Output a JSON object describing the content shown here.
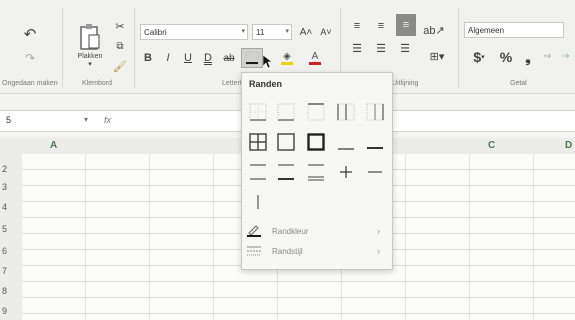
{
  "ribbon": {
    "undo_label": "Ongedaan maken",
    "clipboard_label": "Klembord",
    "paste_label": "Plakken",
    "font_group_label": "Lettertype",
    "align_group_label": "Uitlijning",
    "number_group_label": "Getal",
    "font_name": "Calibri",
    "font_size": "11",
    "grow_font": "A˄",
    "shrink_font": "A˅",
    "bold": "B",
    "italic": "I",
    "underline": "U",
    "double_underline": "D",
    "strikethrough": "ab",
    "number_format": "Algemeen",
    "currency": "$",
    "percent": "%",
    "comma": "❟"
  },
  "formula_bar": {
    "name_box": "5",
    "fx": "fx"
  },
  "columns": [
    "A",
    "C",
    "D"
  ],
  "rows": [
    "2",
    "3",
    "4",
    "5",
    "6",
    "7",
    "8",
    "9"
  ],
  "borders_menu": {
    "title": "Randen",
    "border_color": "Randkleur",
    "border_style": "Randstijl"
  },
  "colors": {
    "fill_accent": "#e8d400",
    "font_accent": "#d02020",
    "border_accent": "#1b1b1b"
  }
}
